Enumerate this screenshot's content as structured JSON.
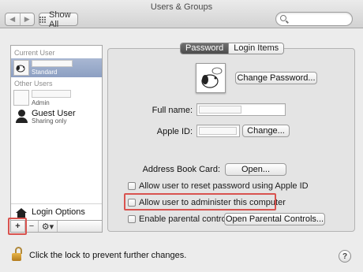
{
  "window": {
    "title": "Users & Groups"
  },
  "toolbar": {
    "back_glyph": "◀",
    "forward_glyph": "▶",
    "show_all_label": "Show All",
    "search_placeholder": ""
  },
  "sidebar": {
    "current_user_heading": "Current User",
    "current_user_role": "Standard",
    "other_users_heading": "Other Users",
    "other_user_role": "Admin",
    "guest_name": "Guest User",
    "guest_status": "Sharing only",
    "login_options_label": "Login Options",
    "add_glyph": "+",
    "remove_glyph": "−",
    "gear_glyph": "⚙▾"
  },
  "tabs": [
    {
      "label": "Password",
      "active": true
    },
    {
      "label": "Login Items",
      "active": false
    }
  ],
  "form": {
    "change_password_label": "Change Password...",
    "full_name_label": "Full name:",
    "full_name_value": "",
    "apple_id_label": "Apple ID:",
    "apple_id_value": "",
    "change_label": "Change...",
    "address_book_label": "Address Book Card:",
    "open_label": "Open...",
    "checkboxes": [
      {
        "label": "Allow user to reset password using Apple ID",
        "checked": false
      },
      {
        "label": "Allow user to administer this computer",
        "checked": false
      },
      {
        "label": "Enable parental controls",
        "checked": false
      }
    ],
    "open_parental_label": "Open Parental Controls..."
  },
  "footer": {
    "lock_text": "Click the lock to prevent further changes.",
    "help_glyph": "?"
  },
  "colors": {
    "highlight": "#d9534f",
    "selection": "#8c9fc2"
  }
}
